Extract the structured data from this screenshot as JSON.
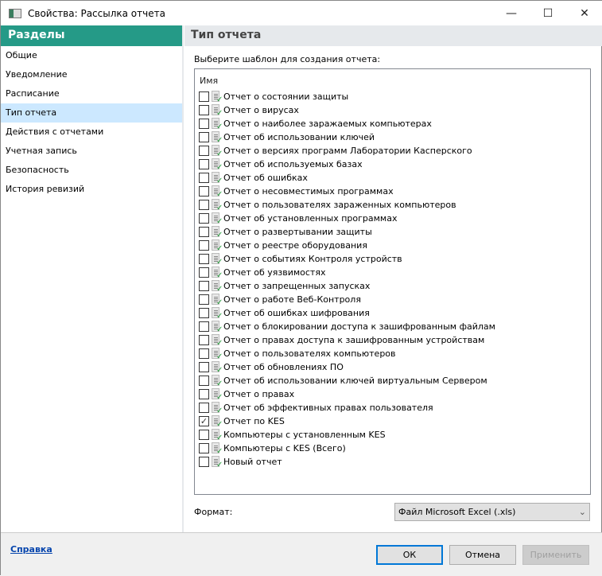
{
  "window": {
    "title": "Свойства: Рассылка отчета",
    "minimize": "—",
    "maximize": "☐",
    "close": "✕"
  },
  "sidebar": {
    "header": "Разделы",
    "items": [
      {
        "label": "Общие",
        "selected": false
      },
      {
        "label": "Уведомление",
        "selected": false
      },
      {
        "label": "Расписание",
        "selected": false
      },
      {
        "label": "Тип отчета",
        "selected": true
      },
      {
        "label": "Действия с отчетами",
        "selected": false
      },
      {
        "label": "Учетная запись",
        "selected": false
      },
      {
        "label": "Безопасность",
        "selected": false
      },
      {
        "label": "История ревизий",
        "selected": false
      }
    ]
  },
  "main": {
    "header": "Тип отчета",
    "prompt": "Выберите шаблон для создания отчета:",
    "column": "Имя",
    "reports": [
      {
        "label": "Отчет о состоянии защиты",
        "checked": false
      },
      {
        "label": "Отчет о вирусах",
        "checked": false
      },
      {
        "label": "Отчет о наиболее заражаемых компьютерах",
        "checked": false
      },
      {
        "label": "Отчет об использовании ключей",
        "checked": false
      },
      {
        "label": "Отчет о версиях программ Лаборатории Касперского",
        "checked": false
      },
      {
        "label": "Отчет об используемых базах",
        "checked": false
      },
      {
        "label": "Отчет об ошибках",
        "checked": false
      },
      {
        "label": "Отчет о несовместимых программах",
        "checked": false
      },
      {
        "label": "Отчет о пользователях зараженных компьютеров",
        "checked": false
      },
      {
        "label": "Отчет об установленных программах",
        "checked": false
      },
      {
        "label": "Отчет о развертывании защиты",
        "checked": false
      },
      {
        "label": "Отчет о реестре оборудования",
        "checked": false
      },
      {
        "label": "Отчет о событиях Контроля устройств",
        "checked": false
      },
      {
        "label": "Отчет об уязвимостях",
        "checked": false
      },
      {
        "label": "Отчет о запрещенных запусках",
        "checked": false
      },
      {
        "label": "Отчет о работе Веб-Контроля",
        "checked": false
      },
      {
        "label": "Отчет об ошибках шифрования",
        "checked": false
      },
      {
        "label": "Отчет о блокировании доступа к зашифрованным файлам",
        "checked": false
      },
      {
        "label": "Отчет о правах доступа к зашифрованным устройствам",
        "checked": false
      },
      {
        "label": "Отчет о пользователях компьютеров",
        "checked": false
      },
      {
        "label": "Отчет об обновлениях ПО",
        "checked": false
      },
      {
        "label": "Отчет об использовании ключей виртуальным Сервером",
        "checked": false
      },
      {
        "label": "Отчет о правах",
        "checked": false
      },
      {
        "label": "Отчет об эффективных правах пользователя",
        "checked": false
      },
      {
        "label": "Отчет по KES",
        "checked": true
      },
      {
        "label": "Компьютеры с установленным KES",
        "checked": false
      },
      {
        "label": "Компьютеры с KES (Всего)",
        "checked": false
      },
      {
        "label": "Новый отчет",
        "checked": false
      }
    ],
    "format_label": "Формат:",
    "format_value": "Файл Microsoft Excel (.xls)"
  },
  "footer": {
    "help": "Справка",
    "ok": "ОК",
    "cancel": "Отмена",
    "apply": "Применить"
  },
  "colors": {
    "accent": "#259a87",
    "selection": "#cce8ff"
  }
}
